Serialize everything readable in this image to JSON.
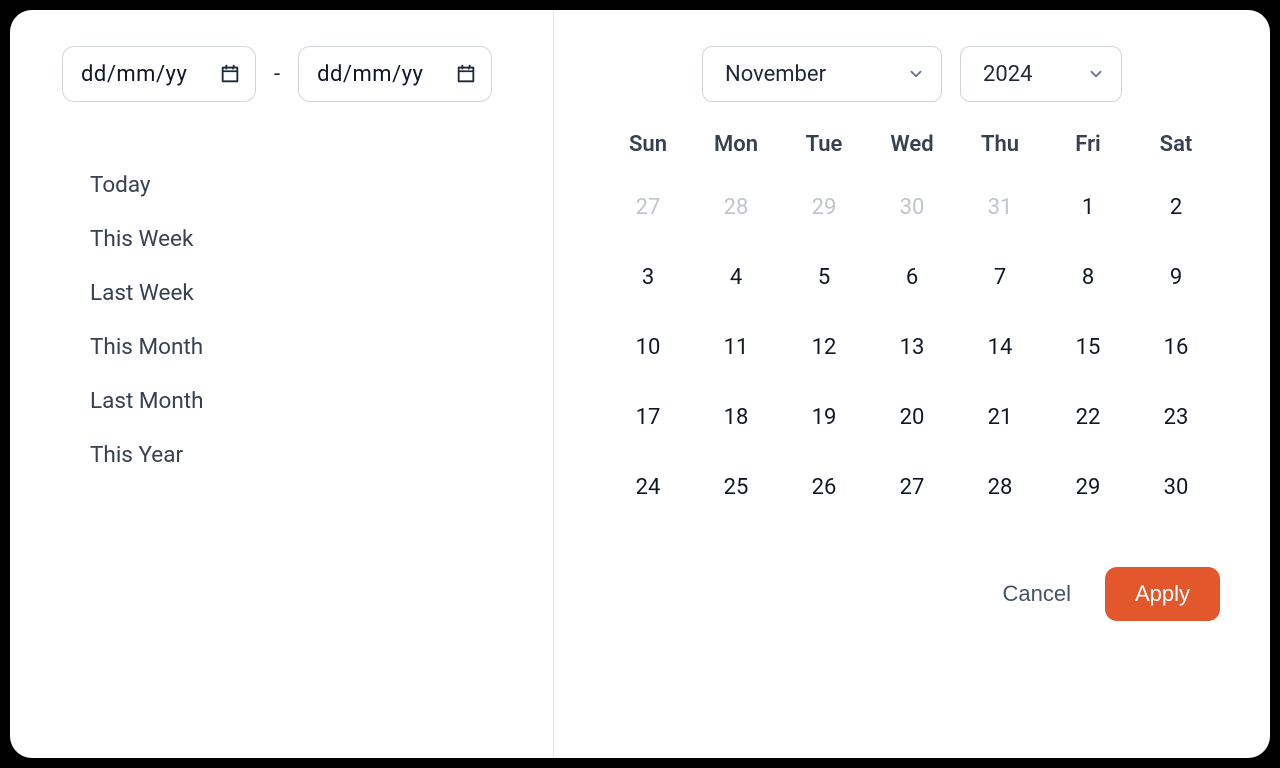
{
  "inputs": {
    "from_placeholder": "dd/mm/yy",
    "to_placeholder": "dd/mm/yy",
    "separator": "-"
  },
  "presets": [
    "Today",
    "This Week",
    "Last Week",
    "This Month",
    "Last Month",
    "This Year"
  ],
  "calendar": {
    "month_label": "November",
    "year_label": "2024",
    "weekday_labels": [
      "Sun",
      "Mon",
      "Tue",
      "Wed",
      "Thu",
      "Fri",
      "Sat"
    ],
    "weeks": [
      [
        {
          "d": "27",
          "other": true
        },
        {
          "d": "28",
          "other": true
        },
        {
          "d": "29",
          "other": true
        },
        {
          "d": "30",
          "other": true
        },
        {
          "d": "31",
          "other": true
        },
        {
          "d": "1",
          "other": false
        },
        {
          "d": "2",
          "other": false
        }
      ],
      [
        {
          "d": "3",
          "other": false
        },
        {
          "d": "4",
          "other": false
        },
        {
          "d": "5",
          "other": false
        },
        {
          "d": "6",
          "other": false
        },
        {
          "d": "7",
          "other": false
        },
        {
          "d": "8",
          "other": false
        },
        {
          "d": "9",
          "other": false
        }
      ],
      [
        {
          "d": "10",
          "other": false
        },
        {
          "d": "11",
          "other": false
        },
        {
          "d": "12",
          "other": false
        },
        {
          "d": "13",
          "other": false
        },
        {
          "d": "14",
          "other": false
        },
        {
          "d": "15",
          "other": false
        },
        {
          "d": "16",
          "other": false
        }
      ],
      [
        {
          "d": "17",
          "other": false
        },
        {
          "d": "18",
          "other": false
        },
        {
          "d": "19",
          "other": false
        },
        {
          "d": "20",
          "other": false
        },
        {
          "d": "21",
          "other": false
        },
        {
          "d": "22",
          "other": false
        },
        {
          "d": "23",
          "other": false
        }
      ],
      [
        {
          "d": "24",
          "other": false
        },
        {
          "d": "25",
          "other": false
        },
        {
          "d": "26",
          "other": false
        },
        {
          "d": "27",
          "other": false
        },
        {
          "d": "28",
          "other": false
        },
        {
          "d": "29",
          "other": false
        },
        {
          "d": "30",
          "other": false
        }
      ]
    ]
  },
  "buttons": {
    "cancel": "Cancel",
    "apply": "Apply"
  }
}
